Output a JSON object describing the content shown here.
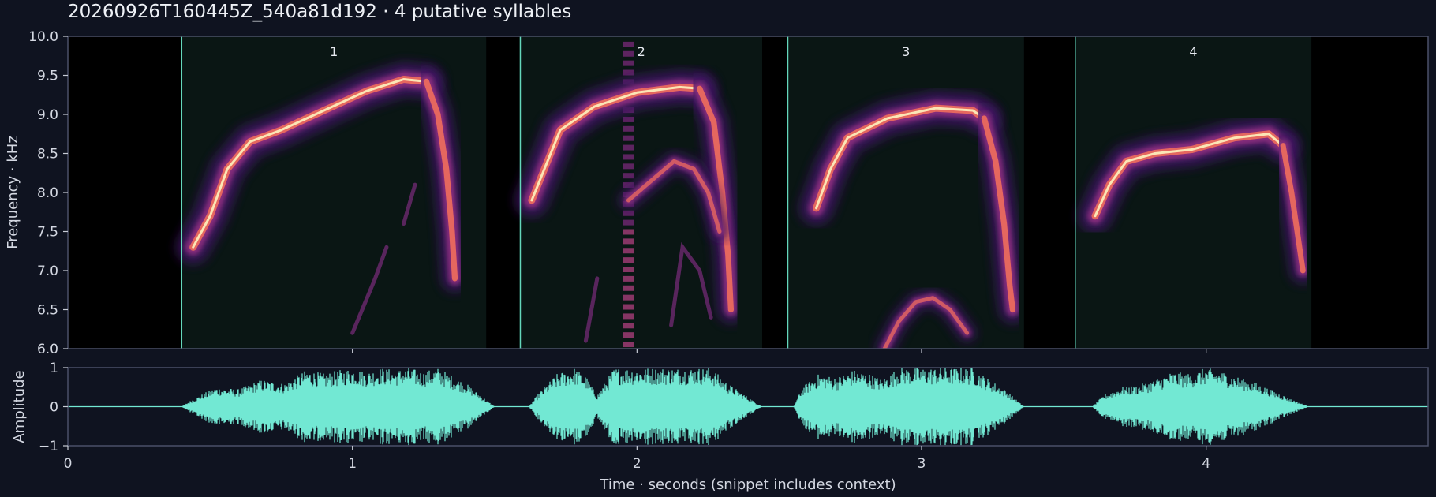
{
  "page": {
    "title": "20260926T160445Z_540a81d192  ·  4 putative syllables"
  },
  "chart_data": [
    {
      "type": "heatmap",
      "name": "spectrogram",
      "ylabel": "Frequency · kHz",
      "xlim": [
        0,
        4.78
      ],
      "ylim": [
        6.0,
        10.0
      ],
      "yticks": [
        "6.0",
        "6.5",
        "7.0",
        "7.5",
        "8.0",
        "8.5",
        "9.0",
        "9.5",
        "10.0"
      ],
      "ytick_values": [
        6.0,
        6.5,
        7.0,
        7.5,
        8.0,
        8.5,
        9.0,
        9.5,
        10.0
      ],
      "xtick_values": [
        1,
        2,
        3,
        4
      ],
      "syllables": [
        {
          "label": "1",
          "start": 0.4,
          "end": 1.47
        },
        {
          "label": "2",
          "start": 1.59,
          "end": 2.44
        },
        {
          "label": "3",
          "start": 2.53,
          "end": 3.36
        },
        {
          "label": "4",
          "start": 3.54,
          "end": 4.37
        }
      ],
      "traces": [
        {
          "points": [
            [
              0.44,
              7.3
            ],
            [
              0.5,
              7.7
            ],
            [
              0.56,
              8.3
            ],
            [
              0.64,
              8.65
            ],
            [
              0.75,
              8.8
            ],
            [
              0.9,
              9.05
            ],
            [
              1.05,
              9.3
            ],
            [
              1.18,
              9.45
            ],
            [
              1.26,
              9.42
            ]
          ],
          "weight": 1.0
        },
        {
          "points": [
            [
              1.26,
              9.42
            ],
            [
              1.3,
              9.0
            ],
            [
              1.33,
              8.3
            ],
            [
              1.35,
              7.5
            ],
            [
              1.36,
              6.9
            ]
          ],
          "weight": 0.75
        },
        {
          "points": [
            [
              1.63,
              7.9
            ],
            [
              1.68,
              8.35
            ],
            [
              1.73,
              8.8
            ],
            [
              1.85,
              9.1
            ],
            [
              2.0,
              9.28
            ],
            [
              2.15,
              9.35
            ],
            [
              2.22,
              9.33
            ]
          ],
          "weight": 1.0
        },
        {
          "points": [
            [
              2.22,
              9.33
            ],
            [
              2.27,
              8.9
            ],
            [
              2.3,
              8.0
            ],
            [
              2.32,
              7.2
            ],
            [
              2.33,
              6.5
            ]
          ],
          "weight": 0.75
        },
        {
          "points": [
            [
              1.97,
              7.9
            ],
            [
              2.05,
              8.15
            ],
            [
              2.13,
              8.4
            ],
            [
              2.2,
              8.3
            ],
            [
              2.25,
              8.0
            ],
            [
              2.29,
              7.5
            ]
          ],
          "weight": 0.45
        },
        {
          "points": [
            [
              2.63,
              7.8
            ],
            [
              2.68,
              8.3
            ],
            [
              2.74,
              8.7
            ],
            [
              2.88,
              8.95
            ],
            [
              3.05,
              9.08
            ],
            [
              3.18,
              9.05
            ],
            [
              3.22,
              8.95
            ]
          ],
          "weight": 1.0
        },
        {
          "points": [
            [
              3.22,
              8.95
            ],
            [
              3.26,
              8.4
            ],
            [
              3.29,
              7.6
            ],
            [
              3.31,
              6.8
            ],
            [
              3.32,
              6.5
            ]
          ],
          "weight": 0.75
        },
        {
          "points": [
            [
              2.87,
              6.0
            ],
            [
              2.92,
              6.35
            ],
            [
              2.98,
              6.6
            ],
            [
              3.04,
              6.65
            ],
            [
              3.1,
              6.5
            ],
            [
              3.16,
              6.2
            ]
          ],
          "weight": 0.4
        },
        {
          "points": [
            [
              3.61,
              7.7
            ],
            [
              3.66,
              8.1
            ],
            [
              3.72,
              8.4
            ],
            [
              3.82,
              8.5
            ],
            [
              3.95,
              8.55
            ],
            [
              4.1,
              8.7
            ],
            [
              4.22,
              8.75
            ],
            [
              4.27,
              8.6
            ]
          ],
          "weight": 1.0
        },
        {
          "points": [
            [
              4.27,
              8.6
            ],
            [
              4.3,
              8.0
            ],
            [
              4.32,
              7.5
            ],
            [
              4.34,
              7.0
            ]
          ],
          "weight": 0.7
        }
      ]
    },
    {
      "type": "area",
      "name": "waveform",
      "xlabel": "Time · seconds (snippet includes context)",
      "ylabel": "Amplitude",
      "xlim": [
        0,
        4.78
      ],
      "ylim": [
        -1,
        1
      ],
      "xticks": [
        "0",
        "1",
        "2",
        "3",
        "4"
      ],
      "xtick_values": [
        0,
        1,
        2,
        3,
        4
      ],
      "yticks": [
        "−1",
        "0",
        "1"
      ],
      "ytick_values": [
        -1,
        0,
        1
      ],
      "envelope": {
        "x": [
          0.0,
          0.4,
          0.44,
          0.52,
          0.6,
          0.68,
          0.76,
          0.84,
          0.9,
          0.96,
          1.0,
          1.05,
          1.1,
          1.15,
          1.2,
          1.25,
          1.3,
          1.35,
          1.4,
          1.45,
          1.5,
          1.62,
          1.66,
          1.72,
          1.78,
          1.82,
          1.86,
          1.92,
          2.0,
          2.1,
          2.2,
          2.26,
          2.32,
          2.38,
          2.44,
          2.55,
          2.58,
          2.64,
          2.7,
          2.76,
          2.82,
          2.86,
          2.92,
          3.0,
          3.1,
          3.18,
          3.24,
          3.3,
          3.36,
          3.6,
          3.64,
          3.7,
          3.76,
          3.82,
          3.88,
          3.94,
          4.0,
          4.06,
          4.12,
          4.18,
          4.24,
          4.3,
          4.36,
          4.78
        ],
        "amp": [
          0.0,
          0.0,
          0.2,
          0.5,
          0.45,
          0.7,
          0.6,
          0.95,
          0.85,
          0.95,
          1.0,
          0.9,
          1.0,
          0.95,
          1.0,
          0.9,
          1.0,
          0.8,
          0.6,
          0.3,
          0.0,
          0.0,
          0.4,
          0.85,
          1.0,
          0.8,
          0.3,
          1.0,
          1.0,
          1.0,
          1.0,
          1.0,
          0.6,
          0.3,
          0.0,
          0.0,
          0.5,
          0.85,
          0.75,
          0.95,
          0.85,
          0.7,
          1.0,
          1.0,
          1.0,
          1.0,
          0.7,
          0.4,
          0.0,
          0.0,
          0.3,
          0.5,
          0.55,
          0.7,
          0.9,
          0.85,
          1.0,
          0.9,
          0.75,
          0.6,
          0.4,
          0.2,
          0.0,
          0.0
        ]
      }
    }
  ],
  "colors": {
    "background": "#0f1320",
    "plot_background": "#000000",
    "segment_shading": "#0a1614",
    "segment_line": "#64d7bb",
    "waveform": "#72e8d3",
    "axis": "#4a5068",
    "text": "#d4d8e2"
  }
}
